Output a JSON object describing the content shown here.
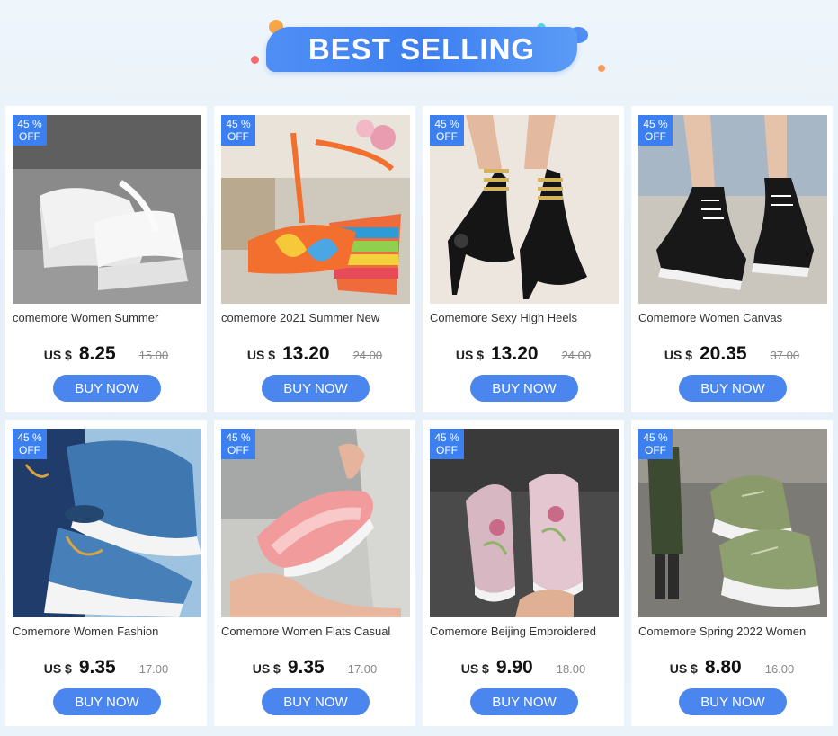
{
  "header": {
    "title": "BEST SELLING"
  },
  "products": [
    {
      "badge_pct": "45 %",
      "badge_off": "OFF",
      "title": "comemore Women Summer",
      "currency": "US $",
      "price": "8.25",
      "old_price": "15.00",
      "cta": "BUY NOW",
      "image": "white-platform-flip-flops"
    },
    {
      "badge_pct": "45 %",
      "badge_off": "OFF",
      "title": "comemore 2021 Summer New",
      "currency": "US $",
      "price": "13.20",
      "old_price": "24.00",
      "cta": "BUY NOW",
      "image": "rainbow-wedge-sandal"
    },
    {
      "badge_pct": "45 %",
      "badge_off": "OFF",
      "title": "Comemore Sexy High Heels",
      "currency": "US $",
      "price": "13.20",
      "old_price": "24.00",
      "cta": "BUY NOW",
      "image": "black-stiletto-heels"
    },
    {
      "badge_pct": "45 %",
      "badge_off": "OFF",
      "title": "Comemore Women Canvas",
      "currency": "US $",
      "price": "20.35",
      "old_price": "37.00",
      "cta": "BUY NOW",
      "image": "canvas-heel-sneakers"
    },
    {
      "badge_pct": "45 %",
      "badge_off": "OFF",
      "title": "Comemore Women Fashion",
      "currency": "US $",
      "price": "9.35",
      "old_price": "17.00",
      "cta": "BUY NOW",
      "image": "blue-denim-slip-on"
    },
    {
      "badge_pct": "45 %",
      "badge_off": "OFF",
      "title": "Comemore Women Flats Casual",
      "currency": "US $",
      "price": "9.35",
      "old_price": "17.00",
      "cta": "BUY NOW",
      "image": "pink-knit-flats"
    },
    {
      "badge_pct": "45 %",
      "badge_off": "OFF",
      "title": "Comemore Beijing Embroidered",
      "currency": "US $",
      "price": "9.90",
      "old_price": "18.00",
      "cta": "BUY NOW",
      "image": "embroidered-loafers"
    },
    {
      "badge_pct": "45 %",
      "badge_off": "OFF",
      "title": "Comemore Spring 2022 Women",
      "currency": "US $",
      "price": "8.80",
      "old_price": "16.00",
      "cta": "BUY NOW",
      "image": "green-knit-sneakers"
    }
  ],
  "colors": {
    "accent": "#4a86ee",
    "badge": "#3b7ff0"
  }
}
